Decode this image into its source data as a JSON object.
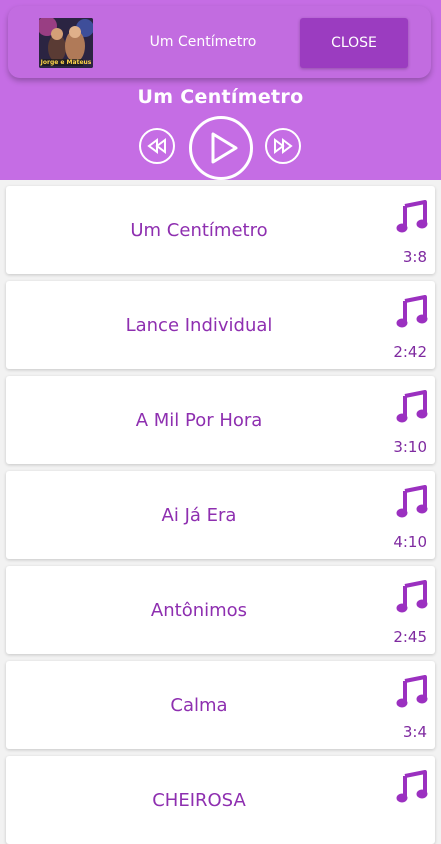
{
  "now_playing": {
    "title": "Um Centímetro",
    "close_label": "CLOSE",
    "thumb_caption": "Jorge e Mateus"
  },
  "player": {
    "title": "Um Centímetro",
    "prev_icon": "rewind-icon",
    "play_icon": "play-icon",
    "next_icon": "fast-forward-icon"
  },
  "songs": [
    {
      "name": "Um Centímetro",
      "duration": "3:8"
    },
    {
      "name": "Lance Individual",
      "duration": "2:42"
    },
    {
      "name": "A Mil Por Hora",
      "duration": "3:10"
    },
    {
      "name": "Ai Já Era",
      "duration": "4:10"
    },
    {
      "name": "Antônimos",
      "duration": "2:45"
    },
    {
      "name": "Calma",
      "duration": "3:4"
    },
    {
      "name": "CHEIROSA",
      "duration": ""
    }
  ],
  "colors": {
    "accent": "#c56de4",
    "song_text": "#8e2fb0",
    "close_button": "#9b3cc0"
  }
}
